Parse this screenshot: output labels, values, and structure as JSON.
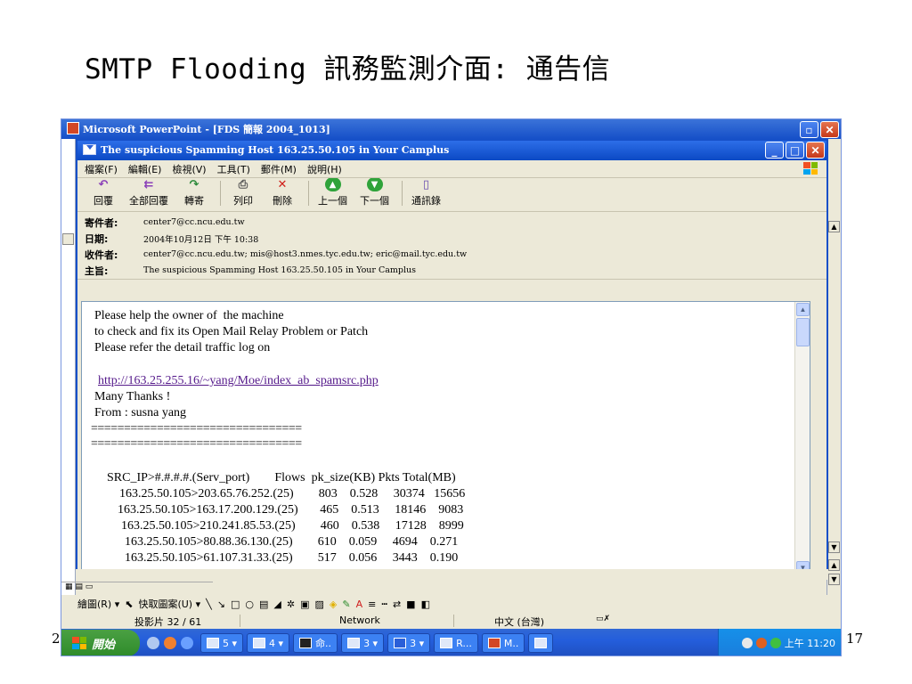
{
  "slide": {
    "title": "SMTP Flooding 訊務監測介面: 通告信",
    "page_number": "17",
    "left_fragment": "2"
  },
  "powerpoint": {
    "window_title": "Microsoft PowerPoint - [FDS 簡報 2004_1013]",
    "draw_label": "繪圖(R) ▾",
    "autoshape_label": "快取圖案(U) ▾",
    "status_slide": "投影片 32 / 61",
    "status_template": "Network",
    "status_language": "中文 (台灣)"
  },
  "outlook": {
    "window_title": "The suspicious Spamming Host 163.25.50.105 in Your Camplus",
    "menu": [
      "檔案(F)",
      "編輯(E)",
      "檢視(V)",
      "工具(T)",
      "郵件(M)",
      "說明(H)"
    ],
    "toolbar": [
      {
        "label": "回覆",
        "icon": "reply-icon"
      },
      {
        "label": "全部回覆",
        "icon": "reply-all-icon"
      },
      {
        "label": "轉寄",
        "icon": "forward-icon"
      },
      {
        "label": "列印",
        "icon": "print-icon"
      },
      {
        "label": "刪除",
        "icon": "delete-icon"
      },
      {
        "label": "上一個",
        "icon": "previous-icon"
      },
      {
        "label": "下一個",
        "icon": "next-icon"
      },
      {
        "label": "通訊錄",
        "icon": "address-book-icon"
      }
    ],
    "headers": {
      "from_label": "寄件者:",
      "from": "center7@cc.ncu.edu.tw",
      "date_label": "日期:",
      "date": "2004年10月12日 下午 10:38",
      "to_label": "收件者:",
      "to": "center7@cc.ncu.edu.tw; mis@host3.nmes.tyc.edu.tw; eric@mail.tyc.edu.tw",
      "subject_label": "主旨:",
      "subject": "The suspicious Spamming Host 163.25.50.105 in Your Camplus"
    },
    "body": {
      "line1": "Please help the owner of  the machine",
      "line2": "to check and fix its Open Mail Relay Problem or Patch",
      "line3": "Please refer the detail traffic log on",
      "link": "http://163.25.255.16/~yang/Moe/index_ab_spamsrc.php",
      "thanks": "Many Thanks !",
      "from_line": "From : susna yang",
      "divider1": "================================",
      "divider2": "================================",
      "table_header": "SRC_IP>#.#.#.#.(Serv_port)        Flows  pk_size(KB) Pkts Total(MB)",
      "rows": [
        "163.25.50.105>203.65.76.252.(25)        803    0.528     30374   15656",
        "163.25.50.105>163.17.200.129.(25)       465    0.513     18146    9083",
        "163.25.50.105>210.241.85.53.(25)        460    0.538     17128    8999",
        "163.25.50.105>80.88.36.130.(25)        610    0.059     4694    0.271",
        "163.25.50.105>61.107.31.33.(25)        517    0.056     3443    0.190"
      ]
    }
  },
  "taskbar": {
    "start": "開始",
    "tasks": [
      "5 ▾",
      "4 ▾",
      "命..",
      "3 ▾",
      "3 ▾",
      "R...",
      "M.."
    ],
    "clock": "上午 11:20"
  },
  "colors": {
    "xp_blue": "#245edc",
    "start_green": "#3a9a35",
    "link": "#551a8b"
  }
}
